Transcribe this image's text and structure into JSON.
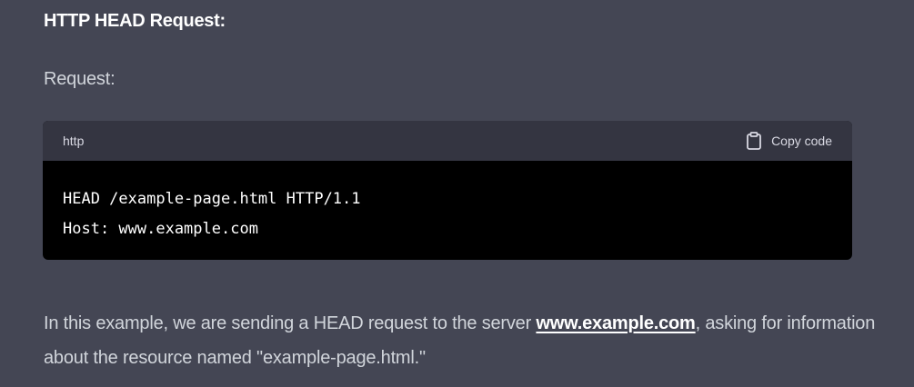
{
  "section": {
    "heading": "HTTP HEAD Request:",
    "request_label": "Request:"
  },
  "code_block": {
    "language": "http",
    "copy_label": "Copy code",
    "lines": [
      "HEAD /example-page.html HTTP/1.1",
      "Host: www.example.com"
    ]
  },
  "explanation": {
    "before_link": "In this example, we are sending a HEAD request to the server ",
    "link_text": "www.example.com",
    "after_link": ", asking for information about the resource named \"example-page.html.\""
  },
  "colors": {
    "background": "#444654",
    "code_header": "#343541",
    "code_body": "#000000"
  }
}
